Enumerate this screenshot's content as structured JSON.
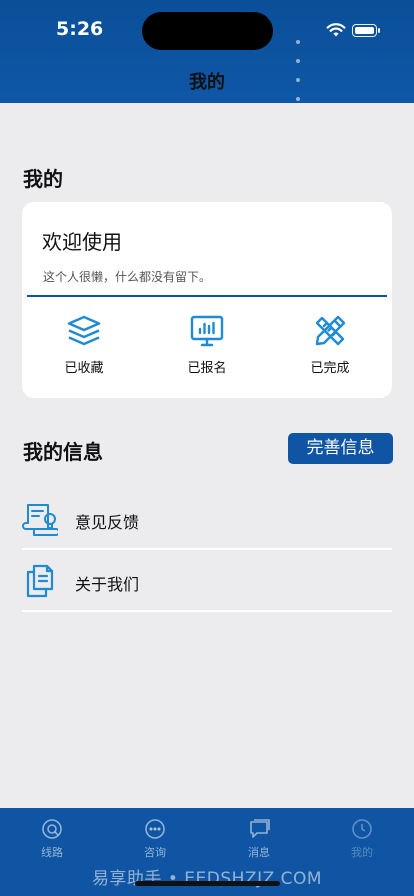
{
  "status_bar": {
    "time": "5:26"
  },
  "header": {
    "title": "我的"
  },
  "profile_section": {
    "title": "我的",
    "welcome": "欢迎使用",
    "motto": "这个人很懒，什么都没有留下。",
    "stats": [
      {
        "label": "已收藏",
        "icon": "layers-icon"
      },
      {
        "label": "已报名",
        "icon": "chart-screen-icon"
      },
      {
        "label": "已完成",
        "icon": "pencil-ruler-icon"
      }
    ]
  },
  "info_section": {
    "title": "我的信息",
    "complete_button": "完善信息",
    "rows": [
      {
        "label": "意见反馈",
        "icon": "feedback-scroll-icon"
      },
      {
        "label": "关于我们",
        "icon": "documents-icon"
      }
    ]
  },
  "tabbar": {
    "tabs": [
      {
        "label": "线路",
        "icon": "route-icon"
      },
      {
        "label": "咨询",
        "icon": "chat-icon"
      },
      {
        "label": "消息",
        "icon": "message-icon"
      },
      {
        "label": "我的",
        "icon": "profile-icon"
      }
    ]
  },
  "watermark": "易享助手 • EEDSHZJZ.COM",
  "colors": {
    "primary": "#0F55A3",
    "background": "#ECEBEE",
    "icon_accent": "#1E8BD2"
  }
}
